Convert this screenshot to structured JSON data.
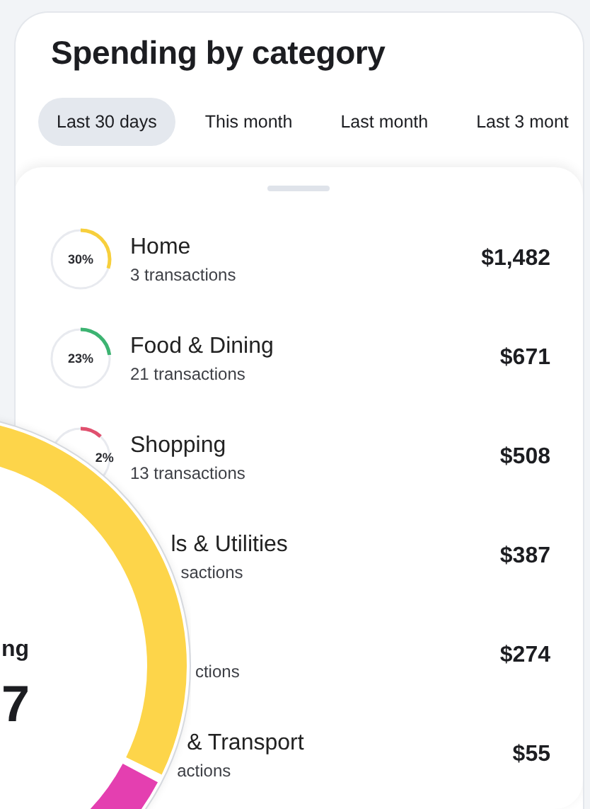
{
  "title": "Spending by category",
  "tabs": [
    {
      "label": "Last 30 days",
      "selected": true
    },
    {
      "label": "This month",
      "selected": false
    },
    {
      "label": "Last month",
      "selected": false
    },
    {
      "label": "Last 3 mont",
      "selected": false
    }
  ],
  "categories": [
    {
      "percent": "30%",
      "level": 0.3,
      "color": "#f7cf3c",
      "name": "Home",
      "subtitle": "3 transactions",
      "amount": "$1,482"
    },
    {
      "percent": "23%",
      "level": 0.23,
      "color": "#3cb371",
      "name": "Food & Dining",
      "subtitle": "21 transactions",
      "amount": "$671"
    },
    {
      "percent": "2%",
      "level": 0.12,
      "color": "#e0506e",
      "name": "Shopping",
      "subtitle": "13 transactions",
      "amount": "$508"
    },
    {
      "name": "ls & Utilities",
      "subtitle": "sactions",
      "amount": "$387"
    },
    {
      "subtitle": "ctions",
      "amount": "$274"
    },
    {
      "name": "& Transport",
      "subtitle": "actions",
      "amount": "$55"
    }
  ],
  "total": {
    "label": "ng",
    "value": "7"
  }
}
